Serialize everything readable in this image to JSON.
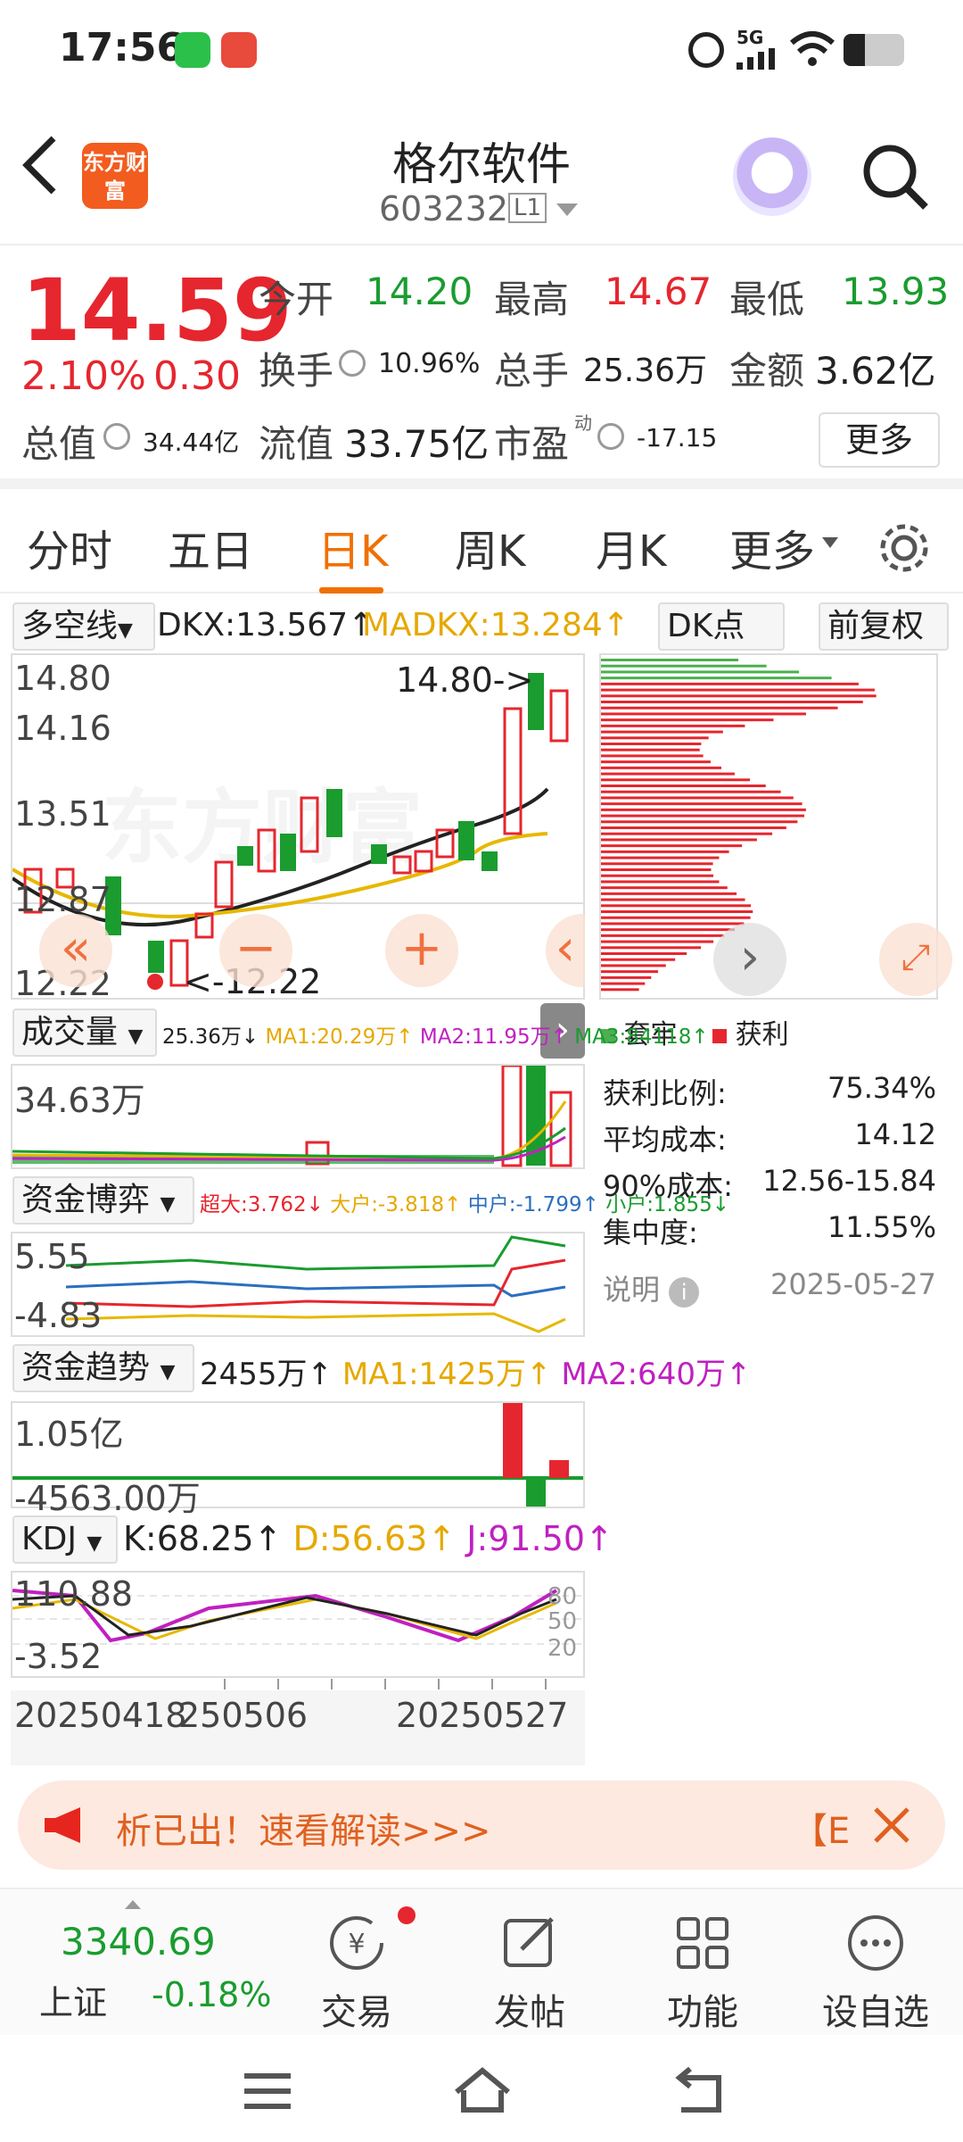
{
  "status": {
    "time": "17:56",
    "network": "5G"
  },
  "header": {
    "back_label": "<",
    "logo_text": "东方财富",
    "title": "格尔软件",
    "code": "603232",
    "level": "L1"
  },
  "quote": {
    "price": "14.59",
    "change_pct": "2.10%",
    "change_abs": "0.30",
    "open_label": "今开",
    "open": "14.20",
    "high_label": "最高",
    "high": "14.67",
    "low_label": "最低",
    "low": "13.93",
    "turnover_label": "换手",
    "turnover": "10.96%",
    "volume_label": "总手",
    "volume": "25.36万",
    "amount_label": "金额",
    "amount": "3.62亿",
    "mktcap_label": "总值",
    "mktcap": "34.44亿",
    "float_label": "流值",
    "float": "33.75亿",
    "pe_label": "市盈",
    "pe_sup": "动",
    "pe": "-17.15",
    "more_button": "更多"
  },
  "tabs": [
    "分时",
    "五日",
    "日K",
    "周K",
    "月K",
    "更多"
  ],
  "active_tab": "日K",
  "kline": {
    "indicator": "多空线",
    "dkx": "DKX:13.567",
    "madkx": "MADKX:13.284",
    "dk_button": "DK点",
    "adjust_button": "前复权",
    "y_labels": [
      "14.80",
      "14.16",
      "13.51",
      "12.87",
      "12.22"
    ],
    "high_marker": "14.80->",
    "low_marker": "<-12.22",
    "watermark": "东方财富"
  },
  "volume_panel": {
    "selector": "成交量",
    "v": "25.36万",
    "ma1": "MA1:20.29万",
    "ma2": "MA2:11.95万",
    "ma3": "MA3:84118",
    "y_top": "34.63万"
  },
  "fund_game": {
    "selector": "资金博弈",
    "super": "超大:3.762",
    "big": "大户:-3.818",
    "mid": "中户:-1.799",
    "small": "小户:1.855",
    "y_top": "5.55",
    "y_bottom": "-4.83"
  },
  "fund_trend": {
    "selector": "资金趋势",
    "v": "2455万",
    "ma1": "MA1:1425万",
    "ma2": "MA2:640万",
    "y_top": "1.05亿",
    "y_bottom": "-4563.00万"
  },
  "kdj": {
    "selector": "KDJ",
    "k": "K:68.25",
    "d": "D:56.63",
    "j": "J:91.50",
    "y_top": "110.88",
    "y_bottom": "-3.52",
    "levels": [
      "80",
      "50",
      "20"
    ]
  },
  "dates": {
    "d1": "20250418",
    "d2": "250506",
    "d3": "20250527"
  },
  "chips": {
    "legend_trapped": "套牢",
    "legend_profit": "获利",
    "rows": [
      {
        "label": "获利比例:",
        "value": "75.34%"
      },
      {
        "label": "平均成本:",
        "value": "14.12"
      },
      {
        "label": "90%成本:",
        "value": "12.56-15.84"
      },
      {
        "label": "集中度:",
        "value": "11.55%"
      }
    ],
    "note_label": "说明",
    "date": "2025-05-27"
  },
  "banner": {
    "text": "析已出！速看解读>>>",
    "tail": "【E"
  },
  "bottom_nav": {
    "index_value": "3340.69",
    "index_name": "上证",
    "index_change": "-0.18%",
    "items": [
      "交易",
      "发帖",
      "功能",
      "设自选"
    ]
  },
  "colors": {
    "up": "#e6262e",
    "down": "#1a9c2f",
    "accent": "#f07000"
  }
}
